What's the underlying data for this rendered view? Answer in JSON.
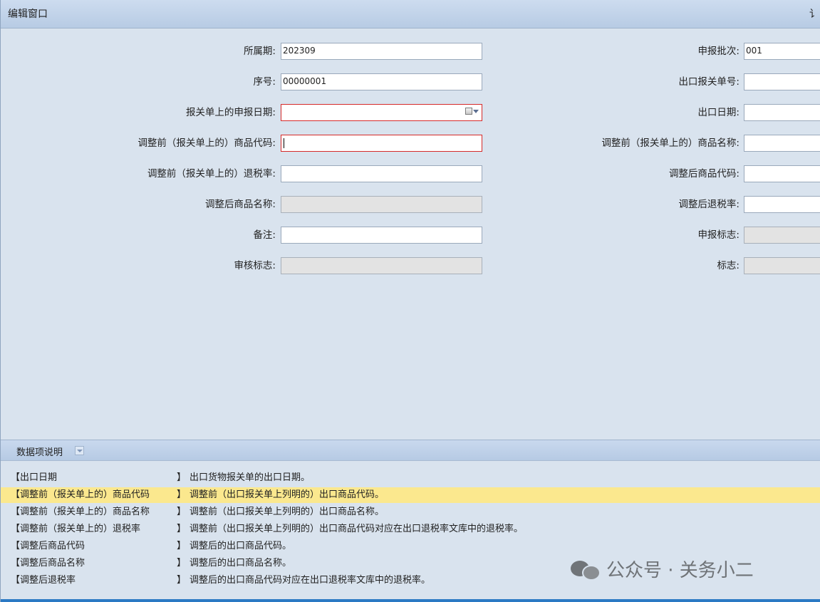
{
  "window": {
    "title": "编辑窗口",
    "right_glyph": "讠"
  },
  "form": {
    "left": [
      {
        "label": "所属期:",
        "value": "202309",
        "state": "normal"
      },
      {
        "label": "序号:",
        "value": "00000001",
        "state": "normal"
      },
      {
        "label": "报关单上的申报日期:",
        "value": "",
        "state": "error-date"
      },
      {
        "label": "调整前（报关单上的）商品代码:",
        "value": "",
        "state": "focused"
      },
      {
        "label": "调整前（报关单上的）退税率:",
        "value": "",
        "state": "normal"
      },
      {
        "label": "调整后商品名称:",
        "value": "",
        "state": "readonly"
      },
      {
        "label": "备注:",
        "value": "",
        "state": "normal"
      },
      {
        "label": "审核标志:",
        "value": "",
        "state": "readonly"
      }
    ],
    "right": [
      {
        "label": "申报批次:",
        "value": "001",
        "state": "normal"
      },
      {
        "label": "出口报关单号:",
        "value": "",
        "state": "normal"
      },
      {
        "label": "出口日期:",
        "value": "",
        "state": "normal"
      },
      {
        "label": "调整前（报关单上的）商品名称:",
        "value": "",
        "state": "normal"
      },
      {
        "label": "调整后商品代码:",
        "value": "",
        "state": "normal"
      },
      {
        "label": "调整后退税率:",
        "value": "",
        "state": "normal"
      },
      {
        "label": "申报标志:",
        "value": "",
        "state": "readonly"
      },
      {
        "label": "标志:",
        "value": "",
        "state": "readonly"
      }
    ]
  },
  "data_items": {
    "title": "数据项说明",
    "bracket_close": "】",
    "rows": [
      {
        "key": "【出口日期",
        "desc": "出口货物报关单的出口日期。",
        "highlight": false
      },
      {
        "key": "【调整前（报关单上的）商品代码",
        "desc": "调整前（出口报关单上列明的）出口商品代码。",
        "highlight": true
      },
      {
        "key": "【调整前（报关单上的）商品名称",
        "desc": "调整前（出口报关单上列明的）出口商品名称。",
        "highlight": false
      },
      {
        "key": "【调整前（报关单上的）退税率",
        "desc": "调整前（出口报关单上列明的）出口商品代码对应在出口退税率文库中的退税率。",
        "highlight": false
      },
      {
        "key": "【调整后商品代码",
        "desc": "调整后的出口商品代码。",
        "highlight": false
      },
      {
        "key": "【调整后商品名称",
        "desc": "调整后的出口商品名称。",
        "highlight": false
      },
      {
        "key": "【调整后退税率",
        "desc": "调整后的出口商品代码对应在出口退税率文库中的退税率。",
        "highlight": false
      }
    ]
  },
  "watermark": {
    "text": "公众号 · 关务小二",
    "icon": "wechat-icon"
  },
  "colors": {
    "highlight": "#fbe88e",
    "error_border": "#d62a2a",
    "accent_bar": "#2b79c4"
  }
}
